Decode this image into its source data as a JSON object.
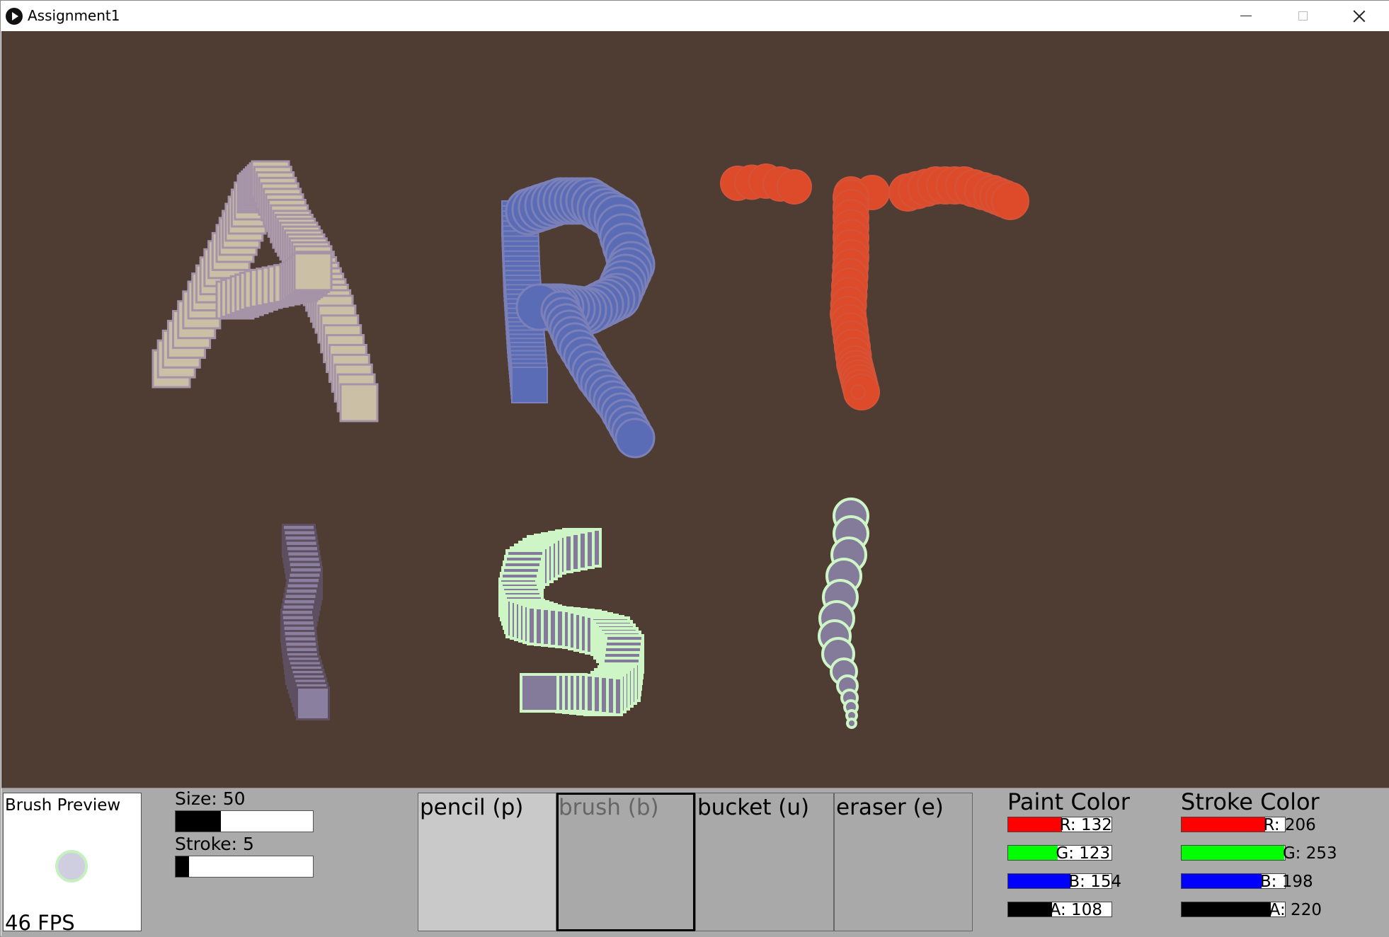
{
  "window": {
    "title": "Assignment1",
    "controls": [
      "minimize",
      "maximize",
      "close"
    ]
  },
  "canvas": {
    "background": "#4f3c33",
    "strokes": [
      {
        "letter": "A",
        "brush": "square",
        "fill": "#cbbfa6",
        "stroke": "#a594a8"
      },
      {
        "letter": "R",
        "brush": "square-then-circle",
        "fill": "#5a6cb5",
        "stroke": "#7c80b8"
      },
      {
        "letter": "T",
        "brush": "circle",
        "fill": "#de4b2a",
        "stroke": "#d4543a"
      },
      {
        "letter": "I",
        "brush": "square",
        "fill": "#8a7f9e",
        "stroke": "#5e4f60"
      },
      {
        "letter": "S",
        "brush": "square",
        "fill": "#847a99",
        "stroke": "#cef5c6"
      },
      {
        "letter": "!",
        "brush": "circle",
        "fill": "#847a9a",
        "stroke": "#cef5c6"
      }
    ]
  },
  "toolbar": {
    "preview": {
      "label": "Brush Preview",
      "fps": "46 FPS",
      "fill": "#cfcde0",
      "stroke": "#c6f0c0"
    },
    "size": {
      "label": "Size: 50",
      "level": 0.33
    },
    "stroke": {
      "label": "Stroke: 5",
      "level": 0.1
    },
    "tools": [
      {
        "id": "pencil",
        "label": "pencil (p)"
      },
      {
        "id": "brush",
        "label": "brush (b)",
        "selected": true
      },
      {
        "id": "bucket",
        "label": "bucket (u)"
      },
      {
        "id": "eraser",
        "label": "eraser (e)"
      }
    ],
    "paint_color": {
      "title": "Paint Color",
      "r": {
        "label": "R: 132",
        "value": 132
      },
      "g": {
        "label": "G: 123",
        "value": 123
      },
      "b": {
        "label": "B: 154",
        "value": 154
      },
      "a": {
        "label": "A: 108",
        "value": 108
      }
    },
    "stroke_color": {
      "title": "Stroke Color",
      "r": {
        "label": "R: 206",
        "value": 206
      },
      "g": {
        "label": "G: 253",
        "value": 253
      },
      "b": {
        "label": "B: 198",
        "value": 198
      },
      "a": {
        "label": "A: 220",
        "value": 220
      }
    }
  }
}
